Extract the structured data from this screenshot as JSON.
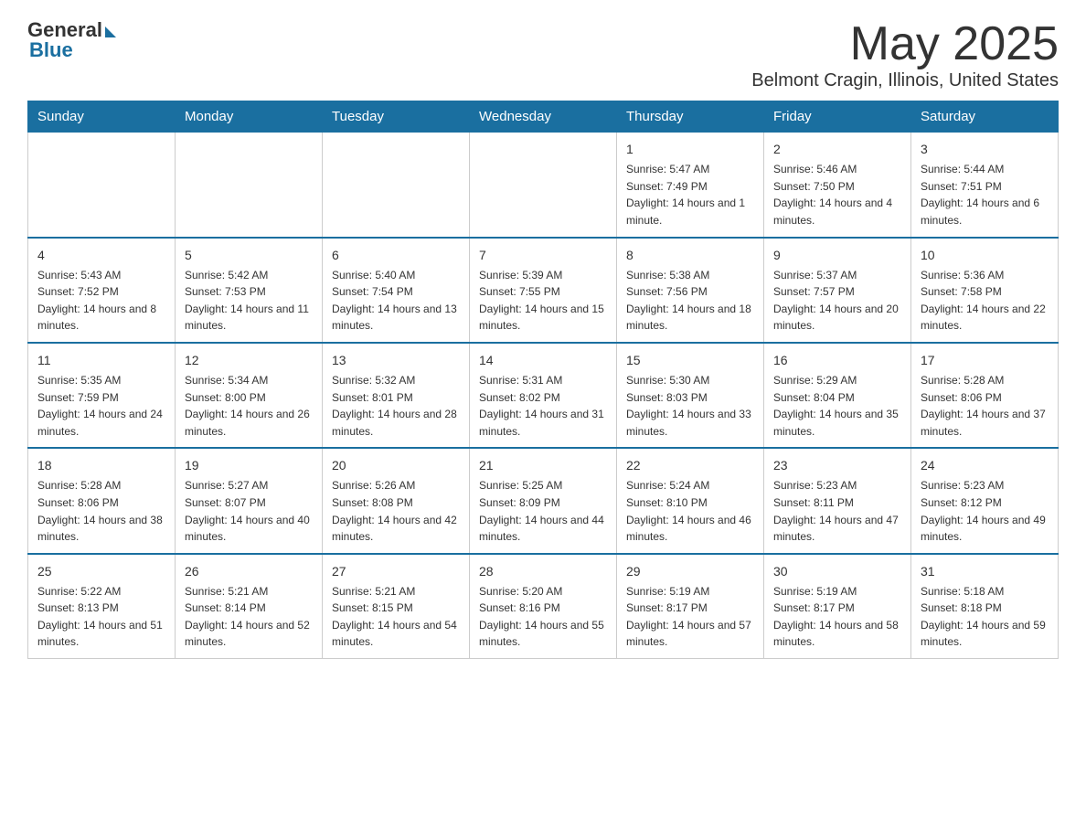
{
  "logo": {
    "general": "General",
    "blue": "Blue"
  },
  "header": {
    "month": "May 2025",
    "location": "Belmont Cragin, Illinois, United States"
  },
  "days_of_week": [
    "Sunday",
    "Monday",
    "Tuesday",
    "Wednesday",
    "Thursday",
    "Friday",
    "Saturday"
  ],
  "weeks": [
    [
      {
        "day": "",
        "info": ""
      },
      {
        "day": "",
        "info": ""
      },
      {
        "day": "",
        "info": ""
      },
      {
        "day": "",
        "info": ""
      },
      {
        "day": "1",
        "info": "Sunrise: 5:47 AM\nSunset: 7:49 PM\nDaylight: 14 hours and 1 minute."
      },
      {
        "day": "2",
        "info": "Sunrise: 5:46 AM\nSunset: 7:50 PM\nDaylight: 14 hours and 4 minutes."
      },
      {
        "day": "3",
        "info": "Sunrise: 5:44 AM\nSunset: 7:51 PM\nDaylight: 14 hours and 6 minutes."
      }
    ],
    [
      {
        "day": "4",
        "info": "Sunrise: 5:43 AM\nSunset: 7:52 PM\nDaylight: 14 hours and 8 minutes."
      },
      {
        "day": "5",
        "info": "Sunrise: 5:42 AM\nSunset: 7:53 PM\nDaylight: 14 hours and 11 minutes."
      },
      {
        "day": "6",
        "info": "Sunrise: 5:40 AM\nSunset: 7:54 PM\nDaylight: 14 hours and 13 minutes."
      },
      {
        "day": "7",
        "info": "Sunrise: 5:39 AM\nSunset: 7:55 PM\nDaylight: 14 hours and 15 minutes."
      },
      {
        "day": "8",
        "info": "Sunrise: 5:38 AM\nSunset: 7:56 PM\nDaylight: 14 hours and 18 minutes."
      },
      {
        "day": "9",
        "info": "Sunrise: 5:37 AM\nSunset: 7:57 PM\nDaylight: 14 hours and 20 minutes."
      },
      {
        "day": "10",
        "info": "Sunrise: 5:36 AM\nSunset: 7:58 PM\nDaylight: 14 hours and 22 minutes."
      }
    ],
    [
      {
        "day": "11",
        "info": "Sunrise: 5:35 AM\nSunset: 7:59 PM\nDaylight: 14 hours and 24 minutes."
      },
      {
        "day": "12",
        "info": "Sunrise: 5:34 AM\nSunset: 8:00 PM\nDaylight: 14 hours and 26 minutes."
      },
      {
        "day": "13",
        "info": "Sunrise: 5:32 AM\nSunset: 8:01 PM\nDaylight: 14 hours and 28 minutes."
      },
      {
        "day": "14",
        "info": "Sunrise: 5:31 AM\nSunset: 8:02 PM\nDaylight: 14 hours and 31 minutes."
      },
      {
        "day": "15",
        "info": "Sunrise: 5:30 AM\nSunset: 8:03 PM\nDaylight: 14 hours and 33 minutes."
      },
      {
        "day": "16",
        "info": "Sunrise: 5:29 AM\nSunset: 8:04 PM\nDaylight: 14 hours and 35 minutes."
      },
      {
        "day": "17",
        "info": "Sunrise: 5:28 AM\nSunset: 8:06 PM\nDaylight: 14 hours and 37 minutes."
      }
    ],
    [
      {
        "day": "18",
        "info": "Sunrise: 5:28 AM\nSunset: 8:06 PM\nDaylight: 14 hours and 38 minutes."
      },
      {
        "day": "19",
        "info": "Sunrise: 5:27 AM\nSunset: 8:07 PM\nDaylight: 14 hours and 40 minutes."
      },
      {
        "day": "20",
        "info": "Sunrise: 5:26 AM\nSunset: 8:08 PM\nDaylight: 14 hours and 42 minutes."
      },
      {
        "day": "21",
        "info": "Sunrise: 5:25 AM\nSunset: 8:09 PM\nDaylight: 14 hours and 44 minutes."
      },
      {
        "day": "22",
        "info": "Sunrise: 5:24 AM\nSunset: 8:10 PM\nDaylight: 14 hours and 46 minutes."
      },
      {
        "day": "23",
        "info": "Sunrise: 5:23 AM\nSunset: 8:11 PM\nDaylight: 14 hours and 47 minutes."
      },
      {
        "day": "24",
        "info": "Sunrise: 5:23 AM\nSunset: 8:12 PM\nDaylight: 14 hours and 49 minutes."
      }
    ],
    [
      {
        "day": "25",
        "info": "Sunrise: 5:22 AM\nSunset: 8:13 PM\nDaylight: 14 hours and 51 minutes."
      },
      {
        "day": "26",
        "info": "Sunrise: 5:21 AM\nSunset: 8:14 PM\nDaylight: 14 hours and 52 minutes."
      },
      {
        "day": "27",
        "info": "Sunrise: 5:21 AM\nSunset: 8:15 PM\nDaylight: 14 hours and 54 minutes."
      },
      {
        "day": "28",
        "info": "Sunrise: 5:20 AM\nSunset: 8:16 PM\nDaylight: 14 hours and 55 minutes."
      },
      {
        "day": "29",
        "info": "Sunrise: 5:19 AM\nSunset: 8:17 PM\nDaylight: 14 hours and 57 minutes."
      },
      {
        "day": "30",
        "info": "Sunrise: 5:19 AM\nSunset: 8:17 PM\nDaylight: 14 hours and 58 minutes."
      },
      {
        "day": "31",
        "info": "Sunrise: 5:18 AM\nSunset: 8:18 PM\nDaylight: 14 hours and 59 minutes."
      }
    ]
  ]
}
